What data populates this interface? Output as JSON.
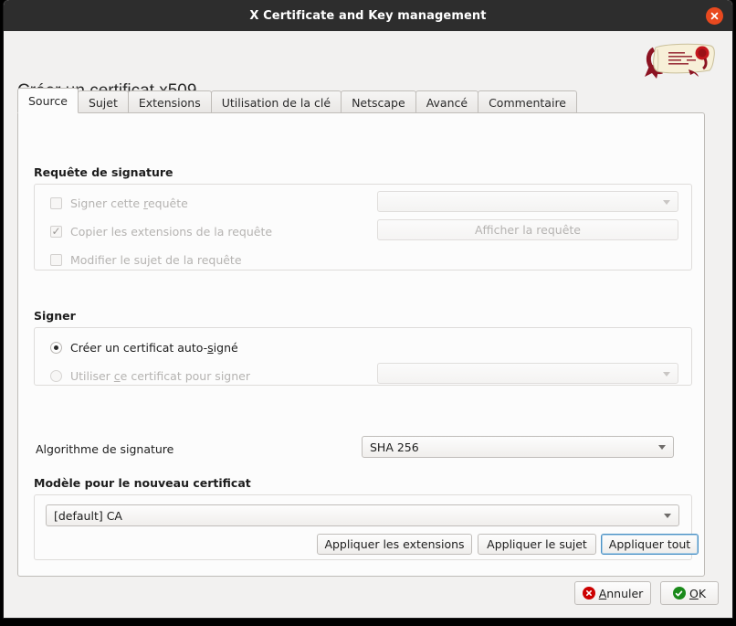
{
  "window": {
    "title": "X Certificate and Key management",
    "close_icon": "close-icon"
  },
  "page": {
    "heading": "Créer un certificat x509",
    "logo_icon": "certificate-scroll-logo"
  },
  "tabs": [
    {
      "label": "Source",
      "active": true
    },
    {
      "label": "Sujet",
      "active": false
    },
    {
      "label": "Extensions",
      "active": false
    },
    {
      "label": "Utilisation de la clé",
      "active": false
    },
    {
      "label": "Netscape",
      "active": false
    },
    {
      "label": "Avancé",
      "active": false
    },
    {
      "label": "Commentaire",
      "active": false
    }
  ],
  "signing_request": {
    "group_title": "Requête de signature",
    "sign_this_request": {
      "label_pre": "Signer cette ",
      "label_mnemonic": "r",
      "label_post": "equête",
      "checked": false,
      "enabled": false
    },
    "copy_extensions": {
      "label": "Copier les extensions de la requête",
      "checked": true,
      "enabled": false,
      "check_glyph": "✓"
    },
    "modify_subject": {
      "label": "Modifier le sujet de la requête",
      "checked": false,
      "enabled": false
    },
    "request_combo_value": "",
    "show_request_button": "Afficher la requête"
  },
  "sign": {
    "group_title": "Signer",
    "self_signed": {
      "label_pre": "Créer un certificat auto-",
      "label_mnemonic": "s",
      "label_post": "igné",
      "selected": true,
      "enabled": true
    },
    "use_certificate": {
      "label_pre": "Utiliser ",
      "label_mnemonic": "c",
      "label_post": "e certificat pour signer",
      "selected": false,
      "enabled": false
    },
    "signer_combo_value": ""
  },
  "signature_algorithm": {
    "label": "Algorithme de signature",
    "value": "SHA 256"
  },
  "template": {
    "group_title": "Modèle pour le nouveau certificat",
    "selected": "[default] CA",
    "apply_extensions_button": "Appliquer les extensions",
    "apply_subject_button": "Appliquer le sujet",
    "apply_all_button": "Appliquer tout"
  },
  "actions": {
    "cancel": {
      "pre": "",
      "mnemonic": "A",
      "post": "nnuler",
      "icon": "cancel-icon",
      "color": "#cc0000"
    },
    "ok": {
      "pre": "",
      "mnemonic": "O",
      "post": "K",
      "icon": "ok-icon",
      "color": "#1a8a1a"
    }
  }
}
